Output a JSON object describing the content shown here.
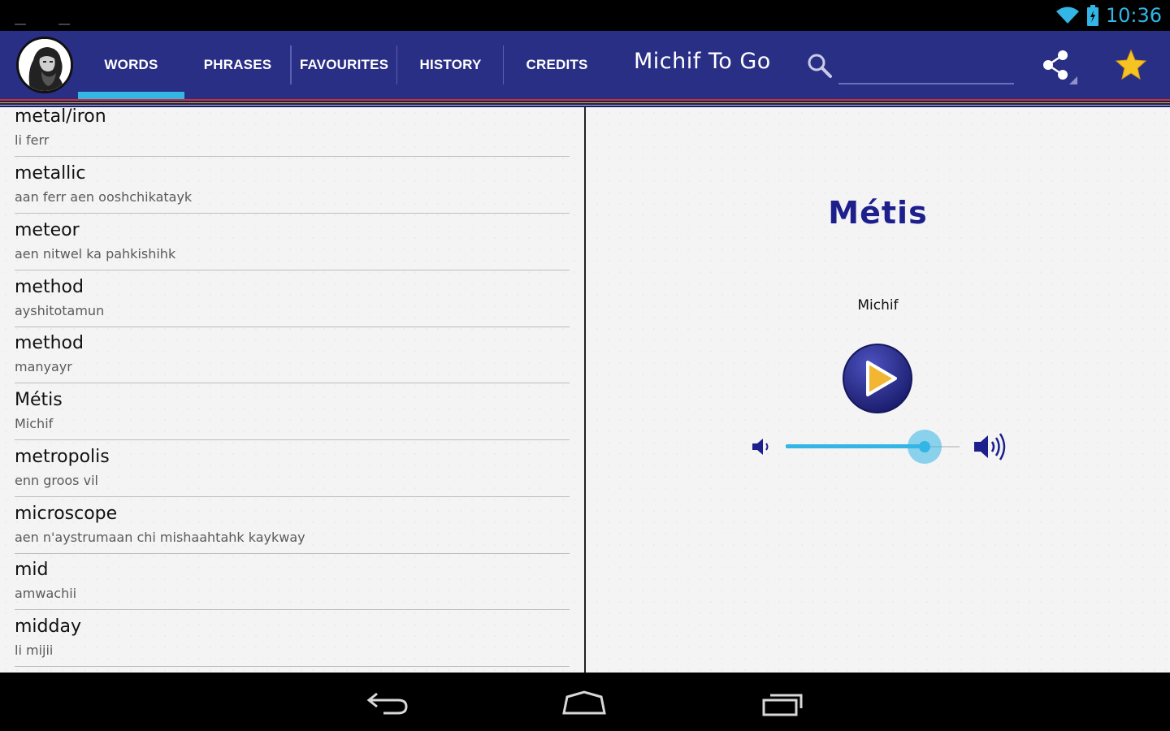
{
  "status_bar": {
    "time": "10:36"
  },
  "app": {
    "title": "Michif To Go",
    "accent": "#33b5e5",
    "bar_color": "#2a2f86"
  },
  "tabs": [
    {
      "label": "WORDS",
      "selected": true
    },
    {
      "label": "PHRASES",
      "selected": false
    },
    {
      "label": "FAVOURITES",
      "selected": false
    },
    {
      "label": "HISTORY",
      "selected": false
    },
    {
      "label": "CREDITS",
      "selected": false
    }
  ],
  "search": {
    "value": "",
    "placeholder": ""
  },
  "icons": {
    "logo": "portrait-logo",
    "search": "search-icon",
    "share": "share-icon",
    "favourite": "star-icon",
    "play": "play-icon",
    "volume_low": "volume-low-icon",
    "volume_high": "volume-high-icon",
    "back": "back-icon",
    "home": "home-icon",
    "recents": "recents-icon"
  },
  "words": [
    {
      "english": "metal/iron",
      "michif": "li ferr"
    },
    {
      "english": "metallic",
      "michif": "aan ferr aen ooshchikatayk"
    },
    {
      "english": "meteor",
      "michif": "aen nitwel ka pahkishihk"
    },
    {
      "english": "method",
      "michif": "ayshitotamun"
    },
    {
      "english": "method",
      "michif": "manyayr"
    },
    {
      "english": "Métis",
      "michif": "Michif"
    },
    {
      "english": "metropolis",
      "michif": "enn groos vil"
    },
    {
      "english": "microscope",
      "michif": "aen n'aystrumaan chi mishaahtahk kaykway"
    },
    {
      "english": "mid",
      "michif": "amwachii"
    },
    {
      "english": "midday",
      "michif": "li mijii"
    }
  ],
  "detail": {
    "word": "Métis",
    "translation": "Michif",
    "volume_level": 0.8
  }
}
